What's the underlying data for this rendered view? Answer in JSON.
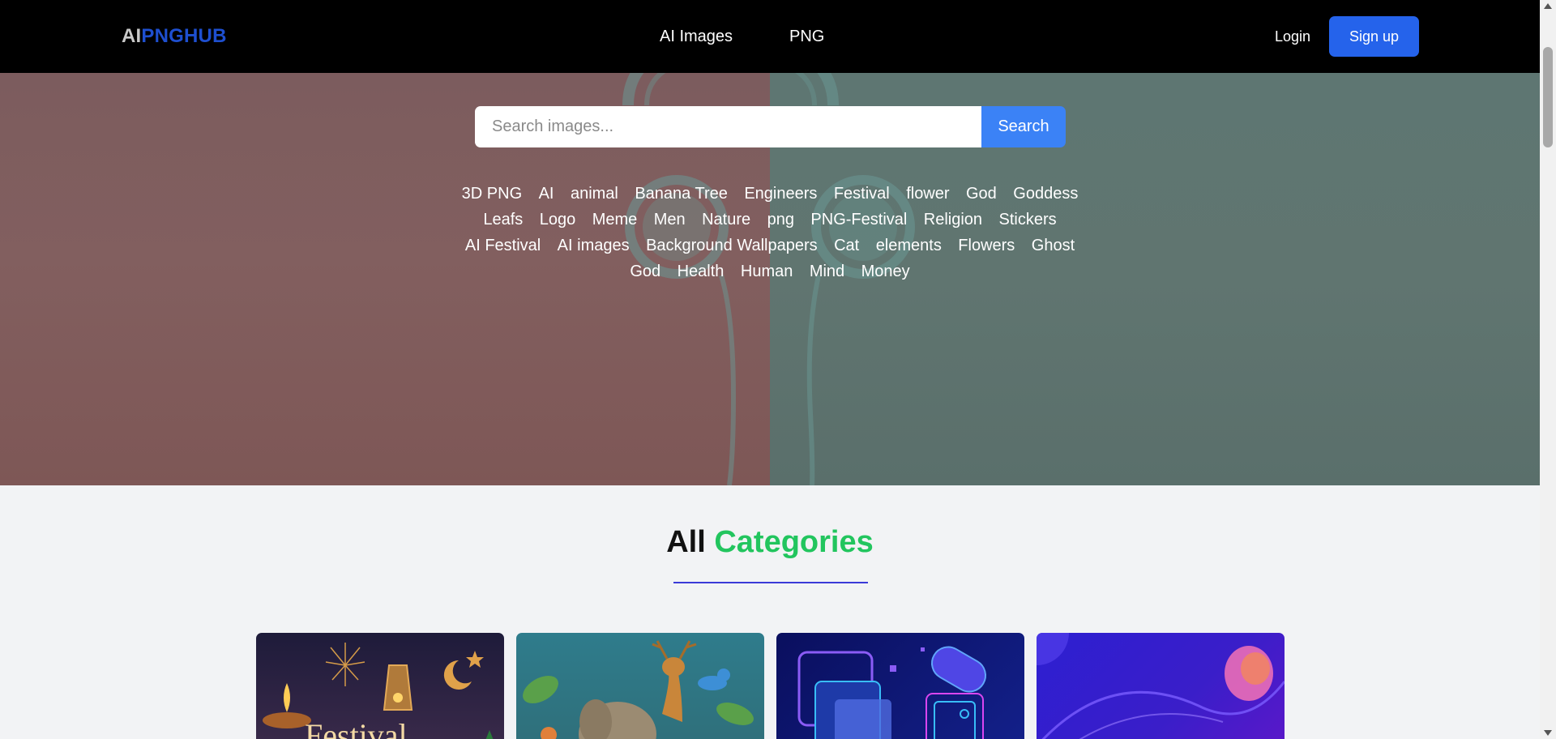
{
  "header": {
    "logo_part1": "AI",
    "logo_part2": "PNGHUB",
    "nav": [
      "AI Images",
      "PNG"
    ],
    "login_label": "Login",
    "signup_label": "Sign up"
  },
  "search": {
    "placeholder": "Search images...",
    "button_label": "Search"
  },
  "tags": [
    "3D PNG",
    "AI",
    "animal",
    "Banana Tree",
    "Engineers",
    "Festival",
    "flower",
    "God",
    "Goddess",
    "Leafs",
    "Logo",
    "Meme",
    "Men",
    "Nature",
    "png",
    "PNG-Festival",
    "Religion",
    "Stickers",
    "AI Festival",
    "AI images",
    "Background Wallpapers",
    "Cat",
    "elements",
    "Flowers",
    "Ghost",
    "God",
    "Health",
    "Human",
    "Mind",
    "Money"
  ],
  "categories": {
    "title_part1": "All",
    "title_part2": "Categories"
  },
  "colors": {
    "brand_blue": "#1e4fd0",
    "signup_blue": "#2563eb",
    "search_blue": "#3b82f6",
    "accent_green": "#22c55e",
    "underline": "#3b3bd8"
  }
}
